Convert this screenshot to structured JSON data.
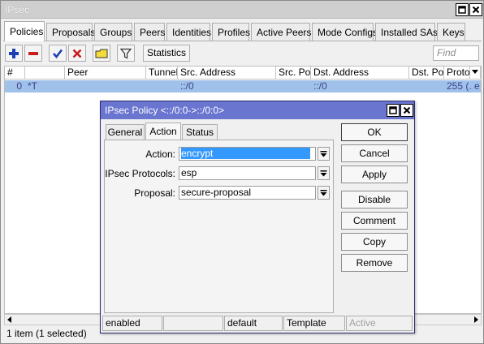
{
  "window": {
    "title": "IPsec"
  },
  "tabs": [
    "Policies",
    "Proposals",
    "Groups",
    "Peers",
    "Identities",
    "Profiles",
    "Active Peers",
    "Mode Configs",
    "Installed SAs",
    "Keys"
  ],
  "toolbar": {
    "statistics_label": "Statistics",
    "find_placeholder": "Find"
  },
  "table": {
    "headers": [
      "#",
      "Peer",
      "Tunnel",
      "Src. Address",
      "Src. Port",
      "Dst. Address",
      "Dst. Port",
      "Proto..."
    ],
    "rows": [
      {
        "num": "0",
        "flag": "*T",
        "peer": "",
        "tunnel": "",
        "src_address": "::/0",
        "src_port": "",
        "dst_address": "::/0",
        "dst_port": "",
        "proto": "255 (...",
        "extra": "e"
      }
    ]
  },
  "status": {
    "count": "1 item (1 selected)"
  },
  "dialog": {
    "title": "IPsec Policy <::/0:0->::/0:0>",
    "tabs": [
      "General",
      "Action",
      "Status"
    ],
    "fields": [
      {
        "label": "Action:",
        "value": "encrypt"
      },
      {
        "label": "IPsec Protocols:",
        "value": "esp"
      },
      {
        "label": "Proposal:",
        "value": "secure-proposal"
      }
    ],
    "buttons": [
      "OK",
      "Cancel",
      "Apply",
      "Disable",
      "Comment",
      "Copy",
      "Remove"
    ],
    "statusbar": [
      "enabled",
      "",
      "default",
      "Template",
      "Active"
    ]
  }
}
